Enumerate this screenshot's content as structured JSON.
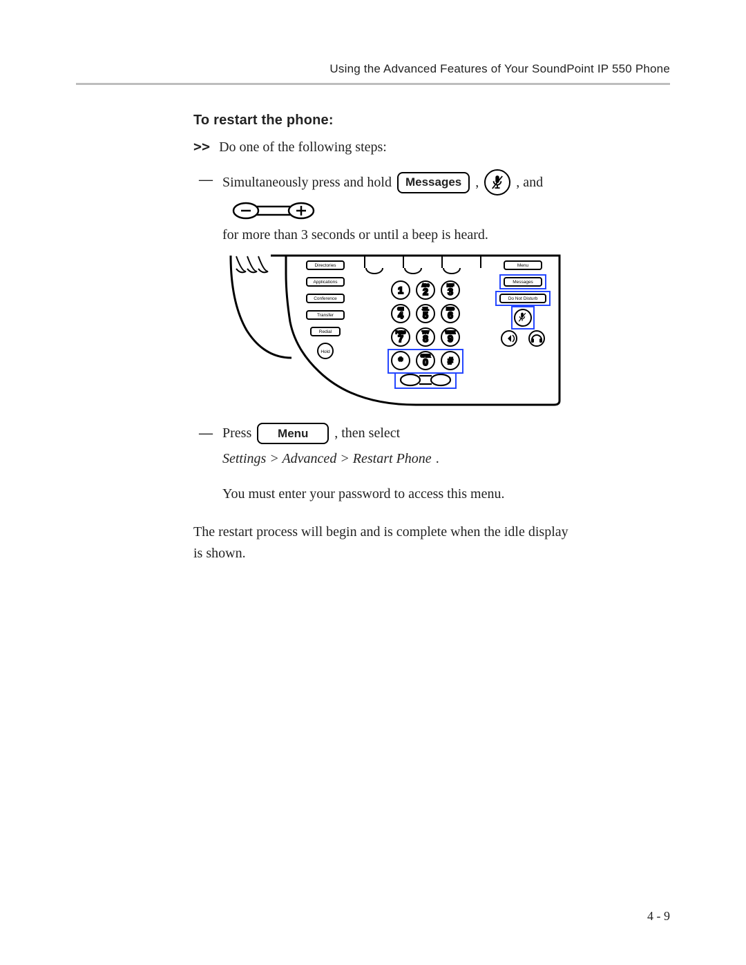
{
  "running_head": "Using the Advanced Features of Your SoundPoint IP 550 Phone",
  "section_title": "To restart the phone:",
  "lead_chevrons": ">>",
  "lead_text": "Do one of the following steps:",
  "option1": {
    "text_before_messages": "Simultaneously press and hold",
    "messages_key": "Messages",
    "comma1": ",",
    "comma_and_and": ", and",
    "tail_line": "for more than 3 seconds or until a beep is heard."
  },
  "option2": {
    "press_word": "Press",
    "menu_key": "Menu",
    "then_select": ", then select ",
    "path_italic": "Settings > Advanced > Restart Phone",
    "period": ".",
    "note": "You must enter your password to access this menu."
  },
  "closing_para": "The restart process will begin and is complete when the idle display is shown.",
  "page_number": "4 - 9",
  "phone_buttons": {
    "left_column": [
      "Directories",
      "Applications",
      "Conference",
      "Transfer",
      "Redial",
      "Hold"
    ],
    "right_column": [
      "Menu",
      "Messages",
      "Do Not Disturb"
    ],
    "dial_keys": [
      "1",
      "2",
      "3",
      "4",
      "5",
      "6",
      "7",
      "8",
      "9",
      "*",
      "0",
      "#"
    ],
    "dial_letters_top": [
      "",
      "ABC",
      "DEF",
      "GHI",
      "JKL",
      "MNO",
      "PQRS",
      "TUV",
      "WXYZ",
      "",
      "OPER",
      ""
    ]
  }
}
